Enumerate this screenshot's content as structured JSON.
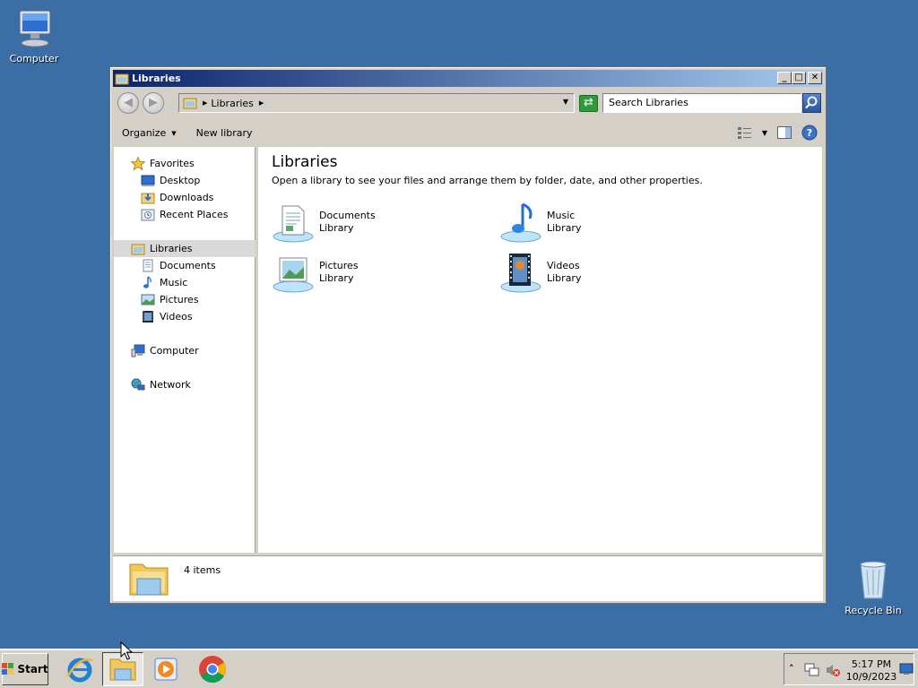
{
  "desktop": {
    "icons": [
      {
        "label": "Computer"
      },
      {
        "label": "Recycle Bin"
      }
    ]
  },
  "window": {
    "title": "Libraries",
    "controls": {
      "minimize": "_",
      "maximize": "□",
      "close": "✕"
    },
    "address": {
      "crumbs": [
        "Libraries"
      ],
      "search_placeholder": "Search Libraries"
    },
    "command_bar": {
      "organize": "Organize",
      "new_library": "New library"
    },
    "nav": {
      "favorites": {
        "label": "Favorites",
        "items": [
          {
            "label": "Desktop"
          },
          {
            "label": "Downloads"
          },
          {
            "label": "Recent Places"
          }
        ]
      },
      "libraries": {
        "label": "Libraries",
        "items": [
          {
            "label": "Documents"
          },
          {
            "label": "Music"
          },
          {
            "label": "Pictures"
          },
          {
            "label": "Videos"
          }
        ]
      },
      "computer": {
        "label": "Computer"
      },
      "network": {
        "label": "Network"
      }
    },
    "main": {
      "title": "Libraries",
      "subtitle": "Open a library to see your files and arrange them by folder, date, and other properties.",
      "libraries": [
        {
          "name": "Documents",
          "type": "Library",
          "icon": "documents-library-icon"
        },
        {
          "name": "Music",
          "type": "Library",
          "icon": "music-library-icon"
        },
        {
          "name": "Pictures",
          "type": "Library",
          "icon": "pictures-library-icon"
        },
        {
          "name": "Videos",
          "type": "Library",
          "icon": "videos-library-icon"
        }
      ]
    },
    "details": {
      "count": "4 items"
    }
  },
  "taskbar": {
    "start_label": "Start",
    "apps": [
      "internet-explorer",
      "windows-explorer",
      "media-player",
      "chrome"
    ],
    "tray": {
      "time": "5:17 PM",
      "date": "10/9/2023"
    }
  },
  "colors": {
    "desktop": "#3a6ea5",
    "titlebar_start": "#0a246a",
    "titlebar_end": "#a6caf0",
    "chrome": "#d4d0c8"
  }
}
